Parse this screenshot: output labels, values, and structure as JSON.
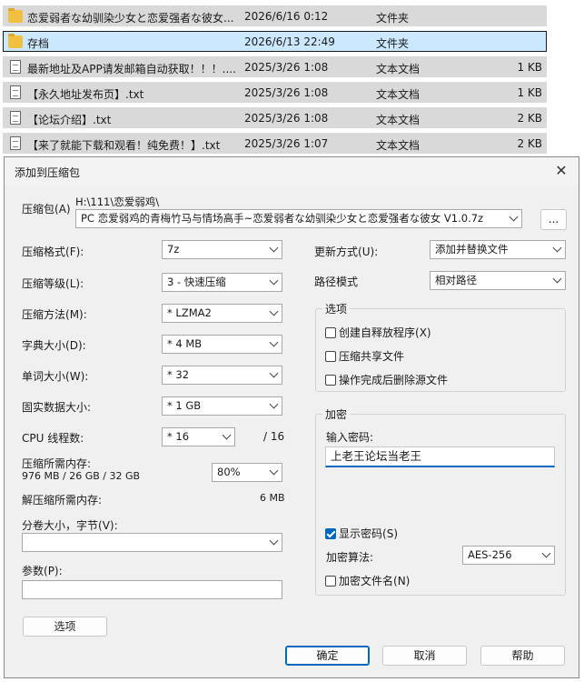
{
  "files": [
    {
      "name": "恋爱弱者な幼驯染少女と恋爱强者な彼女...",
      "date": "2026/6/16 0:12",
      "type": "文件夹",
      "size": "",
      "icon": "folder-icon",
      "selected": false
    },
    {
      "name": "存档",
      "date": "2026/6/13 22:49",
      "type": "文件夹",
      "size": "",
      "icon": "folder-icon",
      "selected": true
    },
    {
      "name": "最新地址及APP请发邮箱自动获取！！！....",
      "date": "2025/3/26 1:08",
      "type": "文本文档",
      "size": "1 KB",
      "icon": "doc-icon",
      "selected": false
    },
    {
      "name": "【永久地址发布页】.txt",
      "date": "2025/3/26 1:08",
      "type": "文本文档",
      "size": "1 KB",
      "icon": "doc-icon",
      "selected": false
    },
    {
      "name": "【论坛介绍】.txt",
      "date": "2025/3/26 1:08",
      "type": "文本文档",
      "size": "2 KB",
      "icon": "doc-icon",
      "selected": false
    },
    {
      "name": "【来了就能下载和观看！纯免费！】.txt",
      "date": "2025/3/26 1:07",
      "type": "文本文档",
      "size": "2 KB",
      "icon": "doc-icon",
      "selected": false
    }
  ],
  "dialog": {
    "title": "添加到压缩包",
    "close": "✕",
    "archive": {
      "label": "压缩包",
      "key": "(A)",
      "path": "H:\\111\\恋爱弱鸡\\",
      "filename": "PC 恋爱弱鸡的青梅竹马与情场高手~恋爱弱者な幼驯染少女と恋爱强者な彼女 V1.0.7z",
      "browse": "..."
    },
    "format": {
      "label": "压缩格式",
      "key": "(F):",
      "value": "7z"
    },
    "level": {
      "label": "压缩等级",
      "key": "(L):",
      "value": "3 - 快速压缩"
    },
    "method": {
      "label": "压缩方法",
      "key": "(M):",
      "value": "*  LZMA2"
    },
    "dict": {
      "label": "字典大小",
      "key": "(D):",
      "value": "*  4 MB"
    },
    "word": {
      "label": "单词大小",
      "key": "(W):",
      "value": "*  32"
    },
    "solid": {
      "label": "固实数据大小",
      "key": ":",
      "value": "*  1 GB"
    },
    "cpu": {
      "label": "CPU 线程数:",
      "value": "*  16",
      "max": "/ 16"
    },
    "mem_compress": {
      "label": "压缩所需内存:",
      "detail": "976 MB / 26 GB / 32 GB",
      "value": "80%"
    },
    "mem_decompress": {
      "label": "解压缩所需内存:",
      "value": "6 MB"
    },
    "volume": {
      "label": "分卷大小，字节",
      "key": "(V):",
      "value": ""
    },
    "params": {
      "label": "参数",
      "key": "(P):",
      "value": ""
    },
    "options_button": "选项",
    "update": {
      "label": "更新方式",
      "key": "(U):",
      "value": "添加并替换文件"
    },
    "pathmode": {
      "label": "路径模式",
      "value": "相对路径"
    },
    "options_group": {
      "title": "选项",
      "sfx": {
        "label": "创建自释放程序",
        "key": "(X)",
        "checked": false
      },
      "shared": {
        "label": "压缩共享文件",
        "checked": false
      },
      "delete": {
        "label": "操作完成后删除源文件",
        "checked": false
      }
    },
    "encryption": {
      "title": "加密",
      "password_label": "输入密码:",
      "password": "上老王论坛当老王",
      "show": {
        "label": "显示密码",
        "key": "(S)",
        "checked": true
      },
      "method_label": "加密算法:",
      "method": "AES-256",
      "encrypt_names": {
        "label": "加密文件名",
        "key": "(N)",
        "checked": false
      }
    },
    "ok": "确定",
    "cancel": "取消",
    "help": "帮助"
  }
}
